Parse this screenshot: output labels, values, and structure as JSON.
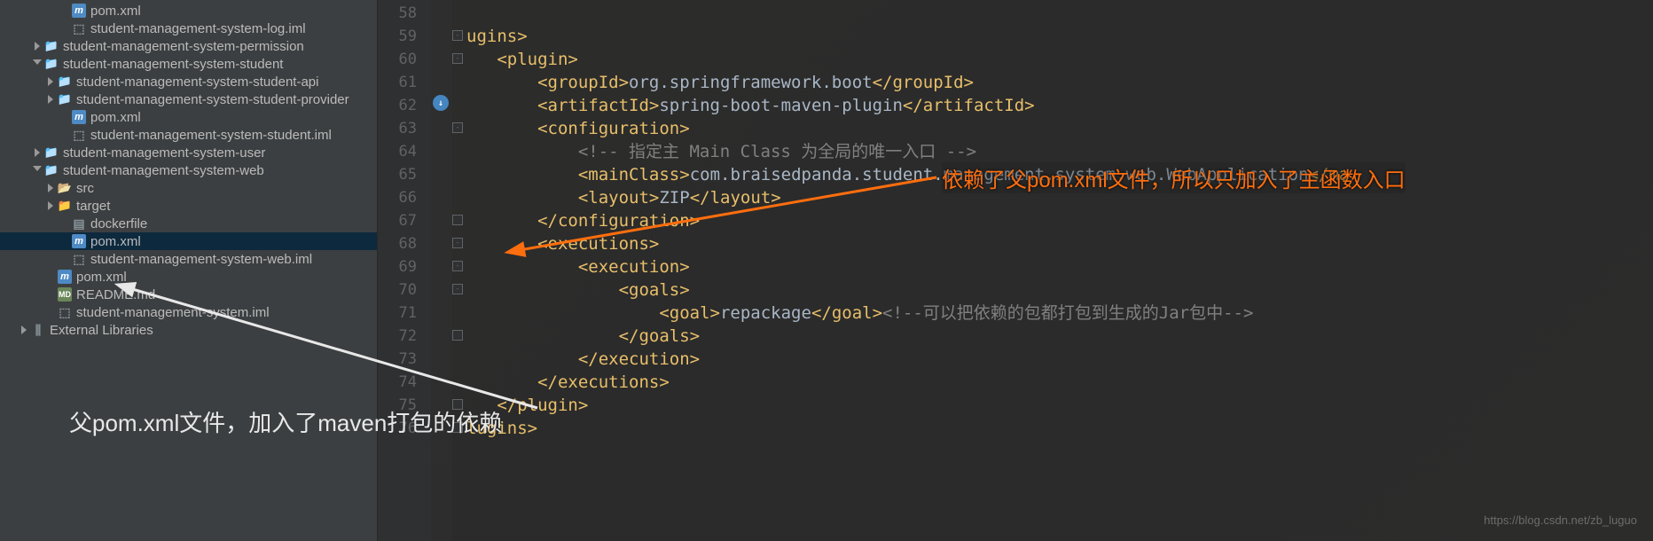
{
  "sidebar": {
    "items": [
      {
        "indent": 60,
        "arrow": "blank",
        "icon": "i-m",
        "label": "pom.xml"
      },
      {
        "indent": 60,
        "arrow": "blank",
        "icon": "i-iml",
        "label": "student-management-system-log.iml"
      },
      {
        "indent": 29,
        "arrow": "right",
        "icon": "i-folder",
        "label": "student-management-system-permission",
        "module": true
      },
      {
        "indent": 29,
        "arrow": "down",
        "icon": "i-folder",
        "label": "student-management-system-student",
        "module": true
      },
      {
        "indent": 44,
        "arrow": "right",
        "icon": "i-folder",
        "label": "student-management-system-student-api",
        "module": true
      },
      {
        "indent": 44,
        "arrow": "right",
        "icon": "i-folder",
        "label": "student-management-system-student-provider",
        "module": true
      },
      {
        "indent": 60,
        "arrow": "blank",
        "icon": "i-m",
        "label": "pom.xml"
      },
      {
        "indent": 60,
        "arrow": "blank",
        "icon": "i-iml",
        "label": "student-management-system-student.iml"
      },
      {
        "indent": 29,
        "arrow": "right",
        "icon": "i-folder",
        "label": "student-management-system-user",
        "module": true
      },
      {
        "indent": 29,
        "arrow": "down",
        "icon": "i-folder",
        "label": "student-management-system-web",
        "module": true
      },
      {
        "indent": 44,
        "arrow": "right",
        "icon": "i-folder-open",
        "label": "src"
      },
      {
        "indent": 44,
        "arrow": "right",
        "icon": "i-folder-orange",
        "label": "target"
      },
      {
        "indent": 60,
        "arrow": "blank",
        "icon": "i-file",
        "label": "dockerfile"
      },
      {
        "indent": 60,
        "arrow": "blank",
        "icon": "i-m",
        "label": "pom.xml",
        "selected": true
      },
      {
        "indent": 60,
        "arrow": "blank",
        "icon": "i-iml",
        "label": "student-management-system-web.iml"
      },
      {
        "indent": 44,
        "arrow": "blank",
        "icon": "i-m",
        "label": "pom.xml"
      },
      {
        "indent": 44,
        "arrow": "blank",
        "icon": "i-md",
        "label": "README.md"
      },
      {
        "indent": 44,
        "arrow": "blank",
        "icon": "i-iml",
        "label": "student-management-system.iml"
      },
      {
        "indent": 14,
        "arrow": "right",
        "icon": "i-lib",
        "label": "External Libraries"
      }
    ]
  },
  "editor": {
    "lineStart": 58,
    "lines": [
      {
        "n": 58,
        "html": ""
      },
      {
        "n": 59,
        "html": "<span class='tag'>ugins&gt;</span>"
      },
      {
        "n": 60,
        "html": "   <span class='tag'>&lt;plugin&gt;</span>"
      },
      {
        "n": 61,
        "html": "       <span class='tag'>&lt;groupId&gt;</span><span class='text'>org.springframework.boot</span><span class='tag'>&lt;/groupId&gt;</span>"
      },
      {
        "n": 62,
        "html": "       <span class='tag'>&lt;artifactId&gt;</span><span class='text'>spring-boot-maven-plugin</span><span class='tag'>&lt;/artifactId&gt;</span>"
      },
      {
        "n": 63,
        "html": "       <span class='tag'>&lt;configuration&gt;</span>"
      },
      {
        "n": 64,
        "html": "           <span class='comment'>&lt;!-- 指定主 Main Class 为全局的唯一入口 --&gt;</span>"
      },
      {
        "n": 65,
        "html": "           <span class='tag'>&lt;mainClass&gt;</span><span class='text'>com.braisedpanda.student.management.system.web.WebApplication</span><span class='tag'>&lt;/ma</span>"
      },
      {
        "n": 66,
        "html": "           <span class='tag'>&lt;layout&gt;</span><span class='text'>ZIP</span><span class='tag'>&lt;/layout&gt;</span>"
      },
      {
        "n": 67,
        "html": "       <span class='tag'>&lt;/configuration&gt;</span>"
      },
      {
        "n": 68,
        "html": "       <span class='tag'>&lt;executions&gt;</span>"
      },
      {
        "n": 69,
        "html": "           <span class='tag'>&lt;execution&gt;</span>"
      },
      {
        "n": 70,
        "html": "               <span class='tag'>&lt;goals&gt;</span>"
      },
      {
        "n": 71,
        "html": "                   <span class='tag'>&lt;goal&gt;</span><span class='text'>repackage</span><span class='tag'>&lt;/goal&gt;</span><span class='comment'>&lt;!--可以把依赖的包都打包到生成的Jar包中--&gt;</span>"
      },
      {
        "n": 72,
        "html": "               <span class='tag'>&lt;/goals&gt;</span>"
      },
      {
        "n": 73,
        "html": "           <span class='tag'>&lt;/execution&gt;</span>"
      },
      {
        "n": 74,
        "html": "       <span class='tag'>&lt;/executions&gt;</span>"
      },
      {
        "n": 75,
        "html": "   <span class='tag'>&lt;/plugin&gt;</span>"
      },
      {
        "n": 76,
        "html": "<span class='tag'>lugins&gt;</span>"
      }
    ],
    "folds": [
      {
        "line": 59,
        "sym": "-"
      },
      {
        "line": 60,
        "sym": "-"
      },
      {
        "line": 63,
        "sym": "-"
      },
      {
        "line": 67,
        "sym": ""
      },
      {
        "line": 68,
        "sym": "-"
      },
      {
        "line": 69,
        "sym": "-"
      },
      {
        "line": 70,
        "sym": "-"
      },
      {
        "line": 72,
        "sym": ""
      },
      {
        "line": 75,
        "sym": ""
      },
      {
        "line": 76,
        "sym": ""
      }
    ]
  },
  "annotations": {
    "note1": "依赖了父pom.xml文件，所以只加入了主函数入口",
    "note2": "父pom.xml文件，加入了maven打包的依赖"
  },
  "watermark": "https://blog.csdn.net/zb_luguo"
}
